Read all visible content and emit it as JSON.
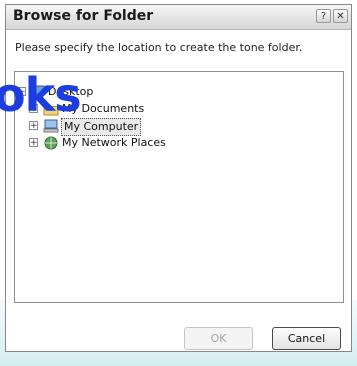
{
  "dialog": {
    "title": "Browse for Folder",
    "instruction": "Please specify the location to create the tone folder.",
    "help_glyph": "?",
    "close_glyph": "✕"
  },
  "watermark": "oks",
  "tree": {
    "items": [
      {
        "label": "Desktop",
        "expander": "−"
      },
      {
        "label": "My Documents",
        "expander": "+"
      },
      {
        "label": "My Computer",
        "expander": "+",
        "selected": true
      },
      {
        "label": "My Network Places",
        "expander": "+"
      }
    ]
  },
  "buttons": {
    "ok_label": "OK",
    "cancel_label": "Cancel"
  }
}
